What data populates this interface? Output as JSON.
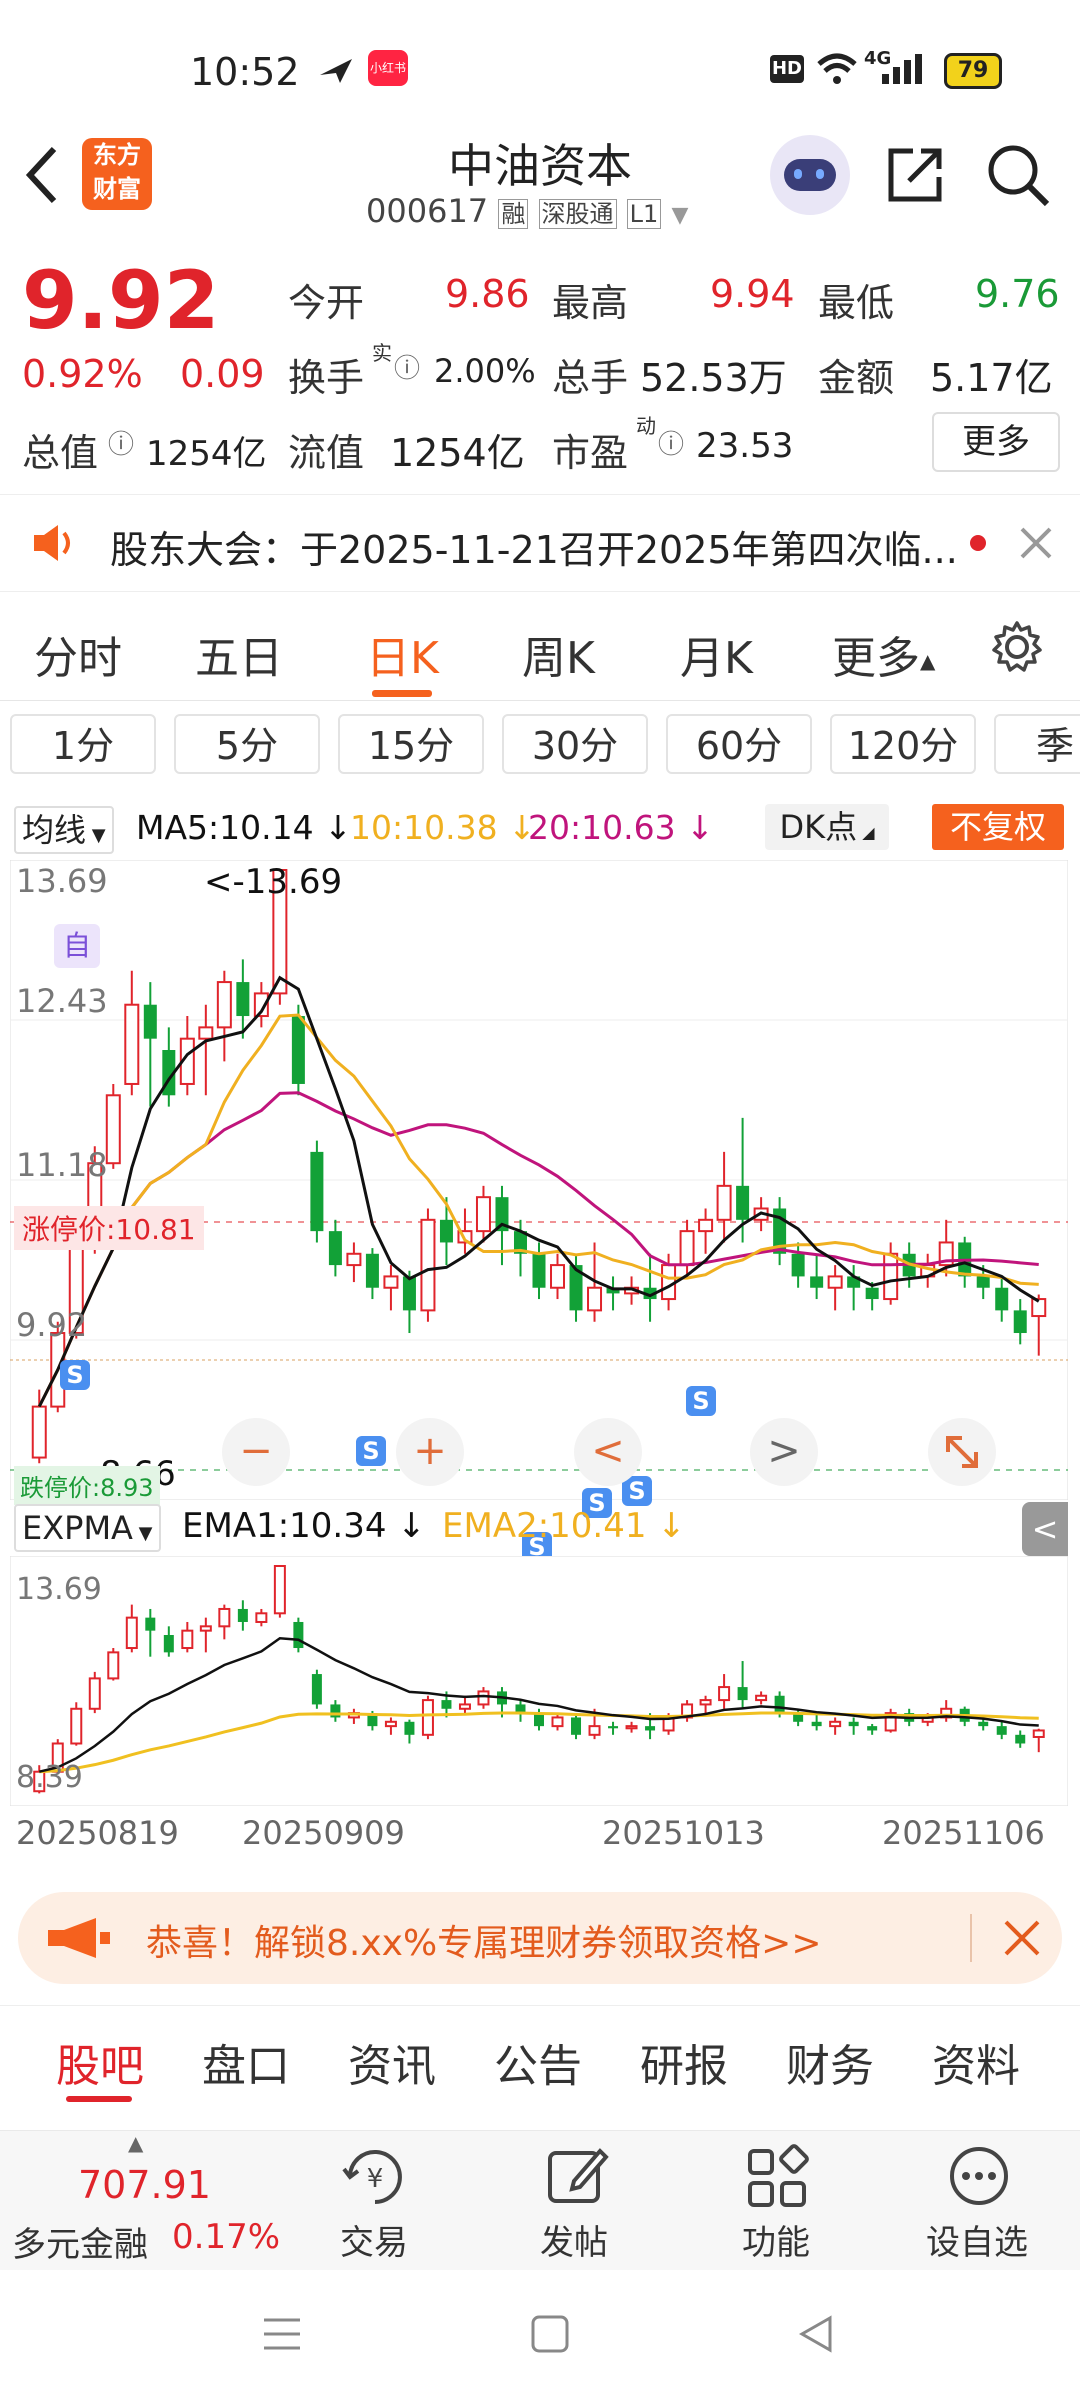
{
  "status": {
    "time": "10:52",
    "app_badge": "小红书",
    "hd": "HD",
    "net": "4G",
    "battery": "79"
  },
  "header": {
    "title": "中油资本",
    "code": "000617",
    "tags": [
      "融",
      "深股通",
      "L1"
    ],
    "brand_line1": "东方",
    "brand_line2": "财富"
  },
  "quote": {
    "price": "9.92",
    "pct": "0.92%",
    "chg": "0.09",
    "open_label": "今开",
    "open": "9.86",
    "high_label": "最高",
    "high": "9.94",
    "low_label": "最低",
    "low": "9.76",
    "turnover_label": "换手",
    "turnover_sup": "实",
    "turnover": "2.00%",
    "volume_label": "总手",
    "volume": "52.53万",
    "amount_label": "金额",
    "amount": "5.17亿",
    "mktcap_label": "总值",
    "mktcap": "1254亿",
    "float_label": "流值",
    "float": "1254亿",
    "pe_label": "市盈",
    "pe_sup": "动",
    "pe": "23.53",
    "more": "更多"
  },
  "notice": {
    "text": "股东大会：于2025-11-21召开2025年第四次临..."
  },
  "tabs": {
    "items": [
      "分时",
      "五日",
      "日K",
      "周K",
      "月K",
      "更多"
    ],
    "active": "日K"
  },
  "periods": {
    "items": [
      "1分",
      "5分",
      "15分",
      "30分",
      "60分",
      "120分",
      "季"
    ]
  },
  "indicator": {
    "select": "均线",
    "ma5": "MA5:10.14",
    "ma10": "10:10.38",
    "ma20": "20:10.63",
    "dk": "DK点",
    "fq": "不复权",
    "ytick_top": "13.69",
    "ytick_2": "12.43",
    "ytick_3": "11.18",
    "ytick_4": "9.92",
    "max_label": "<-13.69",
    "limit_label": "涨停价:10.81",
    "min_label": "8.66",
    "limit_down_label": "跌停价:8.93",
    "self_tag": "自",
    "zoom_out": "−",
    "zoom_in": "+",
    "prev": "<",
    "next": ">"
  },
  "ema": {
    "select": "EXPMA",
    "ema1": "EMA1:10.34",
    "ema2": "EMA2:10.41",
    "ytick_top": "13.69",
    "ytick_bottom": "8.39"
  },
  "xaxis": {
    "labels": [
      "20250819",
      "20250909",
      "20251013",
      "20251106"
    ]
  },
  "colors": {
    "up": "#e0242b",
    "down": "#12a137",
    "ma5": "#111111",
    "ma10": "#f0b020",
    "ma20": "#c0147c",
    "accent": "#f5611e"
  },
  "chart_data": {
    "type": "candlestick",
    "ylim": [
      8.39,
      13.69
    ],
    "candles": [
      [
        8.5,
        8.95,
        8.45,
        9.1
      ],
      [
        8.95,
        9.6,
        8.9,
        9.7
      ],
      [
        9.6,
        10.4,
        9.55,
        10.55
      ],
      [
        10.4,
        11.1,
        10.3,
        11.25
      ],
      [
        11.1,
        11.7,
        11.05,
        11.8
      ],
      [
        11.8,
        12.5,
        11.7,
        12.8
      ],
      [
        12.5,
        12.2,
        11.6,
        12.7
      ],
      [
        12.1,
        11.7,
        11.6,
        12.3
      ],
      [
        11.8,
        12.2,
        11.7,
        12.4
      ],
      [
        12.2,
        12.3,
        11.7,
        12.5
      ],
      [
        12.3,
        12.7,
        12.0,
        12.8
      ],
      [
        12.7,
        12.4,
        12.2,
        12.9
      ],
      [
        12.4,
        12.6,
        12.3,
        12.7
      ],
      [
        12.6,
        13.69,
        12.5,
        13.69
      ],
      [
        12.4,
        11.8,
        11.7,
        12.5
      ],
      [
        11.2,
        10.5,
        10.4,
        11.3
      ],
      [
        10.5,
        10.2,
        10.1,
        10.6
      ],
      [
        10.2,
        10.3,
        10.05,
        10.4
      ],
      [
        10.3,
        10.0,
        9.9,
        10.35
      ],
      [
        10.0,
        10.1,
        9.8,
        10.2
      ],
      [
        10.1,
        9.8,
        9.6,
        10.15
      ],
      [
        9.8,
        10.6,
        9.7,
        10.7
      ],
      [
        10.6,
        10.4,
        10.2,
        10.8
      ],
      [
        10.4,
        10.5,
        10.3,
        10.7
      ],
      [
        10.5,
        10.8,
        10.4,
        10.9
      ],
      [
        10.8,
        10.5,
        10.2,
        10.9
      ],
      [
        10.5,
        10.3,
        10.1,
        10.6
      ],
      [
        10.3,
        10.0,
        9.9,
        10.4
      ],
      [
        10.0,
        10.2,
        9.9,
        10.3
      ],
      [
        10.2,
        9.8,
        9.7,
        10.3
      ],
      [
        9.8,
        10.0,
        9.7,
        10.4
      ],
      [
        10.0,
        9.95,
        9.8,
        10.1
      ],
      [
        9.95,
        10.0,
        9.85,
        10.1
      ],
      [
        10.0,
        9.9,
        9.7,
        10.3
      ],
      [
        9.9,
        10.2,
        9.8,
        10.3
      ],
      [
        10.2,
        10.5,
        10.1,
        10.6
      ],
      [
        10.5,
        10.6,
        10.3,
        10.7
      ],
      [
        10.6,
        10.9,
        10.4,
        11.2
      ],
      [
        10.9,
        10.6,
        10.4,
        11.5
      ],
      [
        10.6,
        10.7,
        10.5,
        10.8
      ],
      [
        10.7,
        10.3,
        10.2,
        10.8
      ],
      [
        10.3,
        10.1,
        10.0,
        10.4
      ],
      [
        10.1,
        10.0,
        9.9,
        10.3
      ],
      [
        10.0,
        10.1,
        9.8,
        10.2
      ],
      [
        10.1,
        10.0,
        9.8,
        10.2
      ],
      [
        10.0,
        9.9,
        9.8,
        10.05
      ],
      [
        9.9,
        10.3,
        9.85,
        10.4
      ],
      [
        10.3,
        10.1,
        10.0,
        10.4
      ],
      [
        10.1,
        10.2,
        10.0,
        10.3
      ],
      [
        10.2,
        10.4,
        10.1,
        10.6
      ],
      [
        10.4,
        10.1,
        10.0,
        10.45
      ],
      [
        10.1,
        10.0,
        9.9,
        10.2
      ],
      [
        10.0,
        9.8,
        9.7,
        10.1
      ],
      [
        9.8,
        9.6,
        9.5,
        9.9
      ],
      [
        9.75,
        9.9,
        9.4,
        9.94
      ]
    ]
  }
}
